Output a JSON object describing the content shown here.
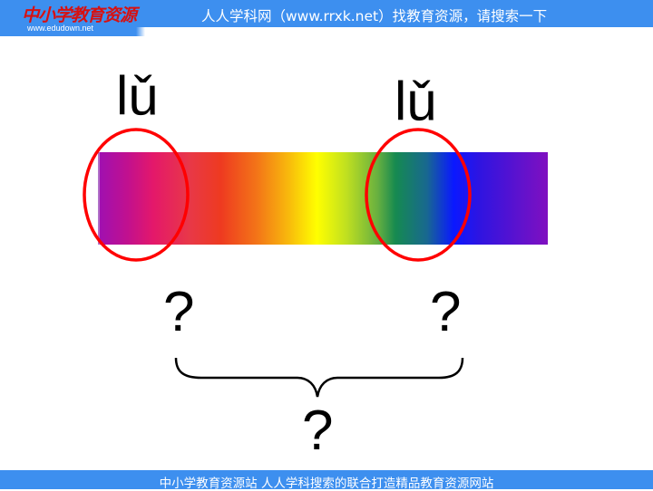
{
  "header": {
    "logo_text": "中小学教育资源",
    "logo_url": "www.edudown.net",
    "banner_text": "人人学科网（www.rrxk.net）找教育资源，请搜索一下"
  },
  "slide": {
    "pinyin_left": "lǔ",
    "pinyin_right": "lǔ",
    "question_left": "?",
    "question_right": "?",
    "question_bottom": "?",
    "colors": {
      "circle": "#ff0000",
      "banner": "#3d8fef"
    }
  },
  "footer": {
    "text": "中小学教育资源站 人人学科搜索的联合打造精品教育资源网站"
  }
}
